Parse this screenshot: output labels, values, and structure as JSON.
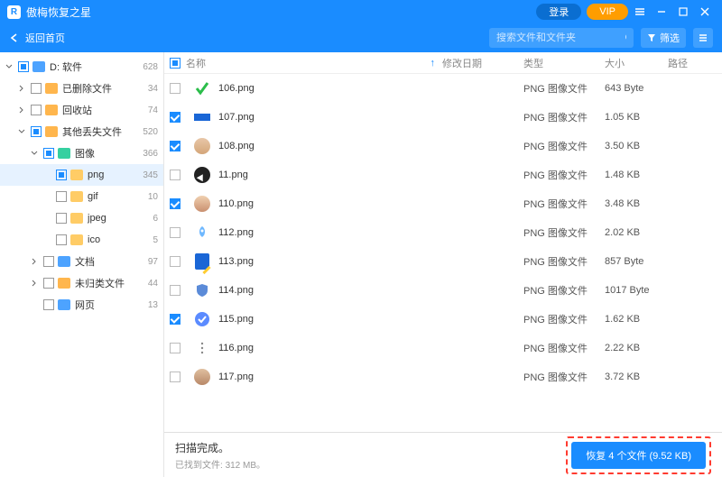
{
  "app": {
    "title": "傲梅恢复之星"
  },
  "titlebar": {
    "login": "登录",
    "vip": "VIP"
  },
  "toolbar": {
    "back": "返回首页",
    "search_placeholder": "搜索文件和文件夹",
    "filter": "筛选"
  },
  "sidebar": [
    {
      "label": "D: 软件",
      "count": "628",
      "indent": 0,
      "chev": "down",
      "cb": "ind",
      "iconColor": "#4da3ff",
      "sel": false
    },
    {
      "label": "已删除文件",
      "count": "34",
      "indent": 1,
      "chev": "right",
      "cb": "empty",
      "iconColor": "#ffb64d",
      "sel": false
    },
    {
      "label": "回收站",
      "count": "74",
      "indent": 1,
      "chev": "right",
      "cb": "empty",
      "iconColor": "#ffb64d",
      "sel": false
    },
    {
      "label": "其他丢失文件",
      "count": "520",
      "indent": 1,
      "chev": "down",
      "cb": "ind",
      "iconColor": "#ffb64d",
      "sel": false
    },
    {
      "label": "图像",
      "count": "366",
      "indent": 2,
      "chev": "down",
      "cb": "ind",
      "iconColor": "#35d0a0",
      "sel": false
    },
    {
      "label": "png",
      "count": "345",
      "indent": 3,
      "chev": "",
      "cb": "ind",
      "iconColor": "#ffcc66",
      "sel": true
    },
    {
      "label": "gif",
      "count": "10",
      "indent": 3,
      "chev": "",
      "cb": "empty",
      "iconColor": "#ffcc66",
      "sel": false
    },
    {
      "label": "jpeg",
      "count": "6",
      "indent": 3,
      "chev": "",
      "cb": "empty",
      "iconColor": "#ffcc66",
      "sel": false
    },
    {
      "label": "ico",
      "count": "5",
      "indent": 3,
      "chev": "",
      "cb": "empty",
      "iconColor": "#ffcc66",
      "sel": false
    },
    {
      "label": "文档",
      "count": "97",
      "indent": 2,
      "chev": "right",
      "cb": "empty",
      "iconColor": "#4da3ff",
      "sel": false
    },
    {
      "label": "未归类文件",
      "count": "44",
      "indent": 2,
      "chev": "right",
      "cb": "empty",
      "iconColor": "#ffb64d",
      "sel": false
    },
    {
      "label": "网页",
      "count": "13",
      "indent": 2,
      "chev": "",
      "cb": "empty",
      "iconColor": "#4da3ff",
      "sel": false
    }
  ],
  "columns": {
    "name": "名称",
    "date": "修改日期",
    "type": "类型",
    "size": "大小",
    "path": "路径"
  },
  "files": [
    {
      "name": "106.png",
      "type": "PNG 图像文件",
      "size": "643 Byte",
      "checked": false,
      "thumb": "check"
    },
    {
      "name": "107.png",
      "type": "PNG 图像文件",
      "size": "1.05 KB",
      "checked": true,
      "thumb": "bar"
    },
    {
      "name": "108.png",
      "type": "PNG 图像文件",
      "size": "3.50 KB",
      "checked": true,
      "thumb": "face1"
    },
    {
      "name": "11.png",
      "type": "PNG 图像文件",
      "size": "1.48 KB",
      "checked": false,
      "thumb": "compass"
    },
    {
      "name": "110.png",
      "type": "PNG 图像文件",
      "size": "3.48 KB",
      "checked": true,
      "thumb": "face2"
    },
    {
      "name": "112.png",
      "type": "PNG 图像文件",
      "size": "2.02 KB",
      "checked": false,
      "thumb": "rocket"
    },
    {
      "name": "113.png",
      "type": "PNG 图像文件",
      "size": "857 Byte",
      "checked": false,
      "thumb": "edit"
    },
    {
      "name": "114.png",
      "type": "PNG 图像文件",
      "size": "1017 Byte",
      "checked": false,
      "thumb": "shield"
    },
    {
      "name": "115.png",
      "type": "PNG 图像文件",
      "size": "1.62 KB",
      "checked": true,
      "thumb": "badge"
    },
    {
      "name": "116.png",
      "type": "PNG 图像文件",
      "size": "2.22 KB",
      "checked": false,
      "thumb": "dots"
    },
    {
      "name": "117.png",
      "type": "PNG 图像文件",
      "size": "3.72 KB",
      "checked": false,
      "thumb": "face3"
    }
  ],
  "footer": {
    "status_title": "扫描完成。",
    "status_sub_label": "已找到文件:",
    "status_sub_value": "312 MB。",
    "recover": "恢复 4 个文件 (9.52 KB)"
  }
}
